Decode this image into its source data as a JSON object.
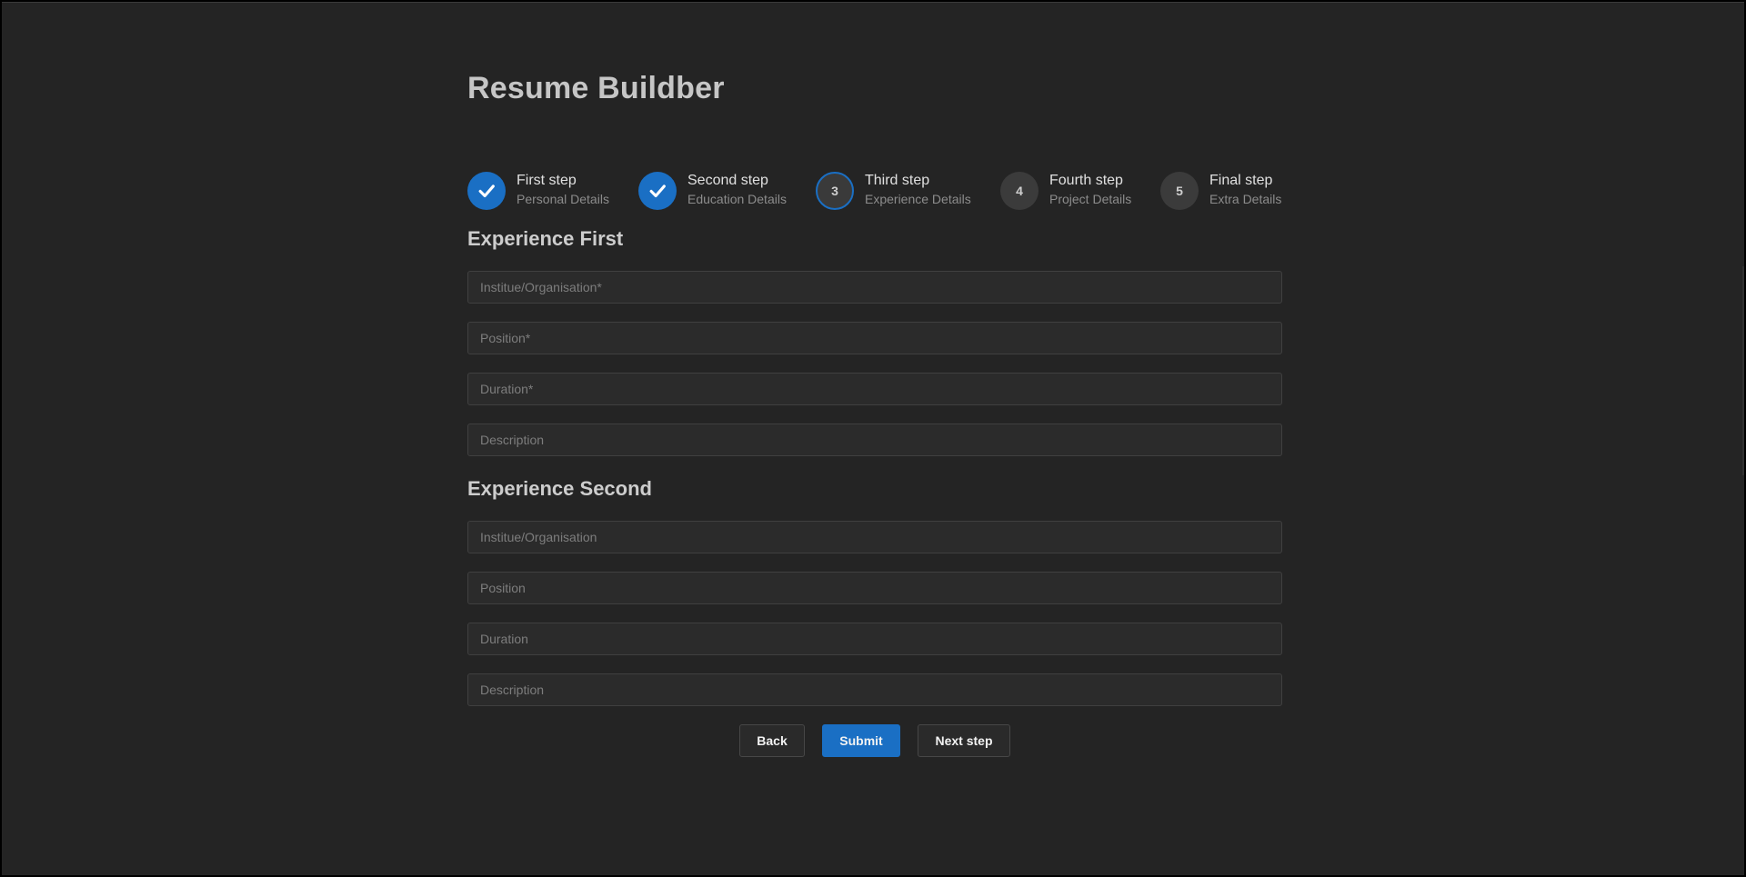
{
  "app": {
    "title": "Resume Buildber"
  },
  "stepper": {
    "steps": [
      {
        "label": "First step",
        "sublabel": "Personal Details",
        "status": "completed",
        "icon": "check-icon"
      },
      {
        "label": "Second step",
        "sublabel": "Education Details",
        "status": "completed",
        "icon": "check-icon"
      },
      {
        "label": "Third step",
        "sublabel": "Experience Details",
        "status": "active",
        "number": "3"
      },
      {
        "label": "Fourth step",
        "sublabel": "Project Details",
        "status": "pending",
        "number": "4"
      },
      {
        "label": "Final step",
        "sublabel": "Extra Details",
        "status": "pending",
        "number": "5"
      }
    ]
  },
  "form": {
    "experience_first": {
      "heading": "Experience First",
      "organisation_placeholder": "Institue/Organisation*",
      "position_placeholder": "Position*",
      "duration_placeholder": "Duration*",
      "description_placeholder": "Description"
    },
    "experience_second": {
      "heading": "Experience Second",
      "organisation_placeholder": "Institue/Organisation",
      "position_placeholder": "Position",
      "duration_placeholder": "Duration",
      "description_placeholder": "Description"
    }
  },
  "actions": {
    "back_label": "Back",
    "submit_label": "Submit",
    "next_label": "Next step"
  },
  "colors": {
    "accent": "#1a6fc4",
    "background": "#242424",
    "field_background": "#2b2b2b",
    "text": "#cdcdcd"
  }
}
